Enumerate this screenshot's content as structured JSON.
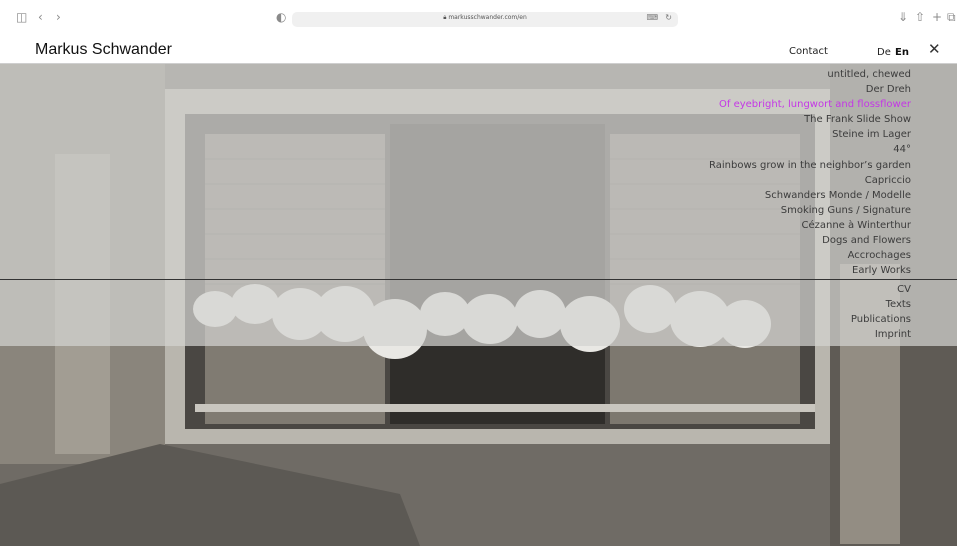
{
  "browser": {
    "url": "markusschwander.com/en",
    "icons": [
      "sidebar-icon",
      "back-icon",
      "forward-icon",
      "privacy-icon",
      "lock-icon",
      "translate-icon",
      "reload-icon",
      "download-icon",
      "share-icon",
      "new-tab-icon",
      "tabs-icon"
    ]
  },
  "header": {
    "site_title": "Markus Schwander",
    "contact": "Contact",
    "lang_de": "De",
    "lang_en": "En"
  },
  "menu": {
    "works": [
      {
        "label": "untitled, chewed",
        "active": false
      },
      {
        "label": "Der Dreh",
        "active": false
      },
      {
        "label": "Of eyebright, lungwort and flossflower",
        "active": true
      },
      {
        "label": "The Frank Slide Show",
        "active": false
      },
      {
        "label": "Steine im Lager",
        "active": false
      },
      {
        "label": "44°",
        "active": false
      },
      {
        "label": "Rainbows grow in the neighbor’s garden",
        "active": false
      },
      {
        "label": "Capriccio",
        "active": false
      },
      {
        "label": "Schwanders Monde / Modelle",
        "active": false
      },
      {
        "label": "Smoking Guns / Signature",
        "active": false
      },
      {
        "label": "Cézanne à Winterthur",
        "active": false
      },
      {
        "label": "Dogs and Flowers",
        "active": false
      },
      {
        "label": "Accrochages",
        "active": false
      },
      {
        "label": "Early Works",
        "active": false
      }
    ],
    "info": [
      {
        "label": "CV"
      },
      {
        "label": "Texts"
      },
      {
        "label": "Publications"
      },
      {
        "label": "Imprint"
      }
    ]
  },
  "colors": {
    "active_link": "#c437e6",
    "text": "#3c3c3c",
    "overlay": "#d2d2d0"
  }
}
